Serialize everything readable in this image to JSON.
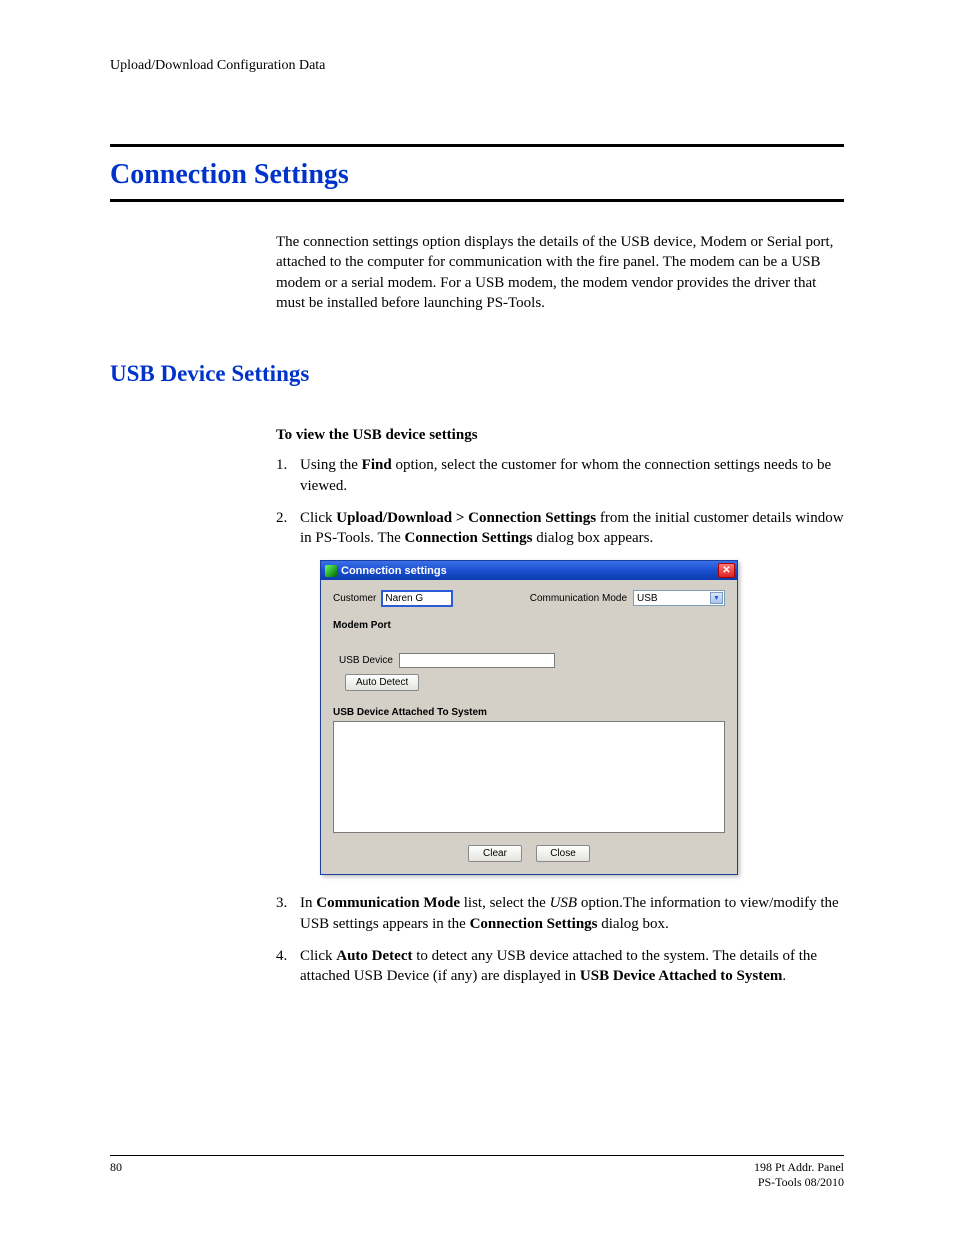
{
  "header": {
    "text": "Upload/Download Configuration Data"
  },
  "section": {
    "title": "Connection Settings",
    "intro": "The connection settings option displays the details of the USB device, Modem or Serial port, attached to the computer for communication with the fire panel. The modem can be a USB modem or a serial modem. For a USB modem, the modem vendor provides the driver that must be installed before launching PS-Tools."
  },
  "subsection": {
    "title": "USB Device Settings",
    "lead": "To view the USB device settings",
    "steps": {
      "s1_a": "Using the ",
      "s1_b": "Find",
      "s1_c": " option, select the customer for whom the connection settings needs to be viewed.",
      "s2_a": "Click ",
      "s2_b": "Upload/Download > Connection Settings",
      "s2_c": " from the initial customer details window in PS-Tools. The ",
      "s2_d": "Connection Settings",
      "s2_e": " dialog box appears.",
      "s3_a": "In ",
      "s3_b": "Communication Mode",
      "s3_c": " list, select the ",
      "s3_d": "USB",
      "s3_e": " option.The information to view/modify the USB settings appears in the ",
      "s3_f": "Connection Settings",
      "s3_g": " dialog box.",
      "s4_a": "Click ",
      "s4_b": "Auto Detect",
      "s4_c": " to detect any USB device attached to the system. The details of the attached USB Device (if any) are displayed in ",
      "s4_d": "USB Device Attached to System",
      "s4_e": "."
    },
    "nums": {
      "n1": "1.",
      "n2": "2.",
      "n3": "3.",
      "n4": "4."
    }
  },
  "dialog": {
    "title": "Connection settings",
    "customer_label": "Customer",
    "customer_value": "Naren G",
    "comm_mode_label": "Communication Mode",
    "comm_mode_value": "USB",
    "modem_port_label": "Modem Port",
    "usb_device_label": "USB Device",
    "auto_detect": "Auto Detect",
    "attached_label": "USB Device Attached To System",
    "clear": "Clear",
    "close": "Close"
  },
  "footer": {
    "page": "80",
    "right1": "198 Pt Addr. Panel",
    "right2": "PS-Tools   08/2010"
  }
}
